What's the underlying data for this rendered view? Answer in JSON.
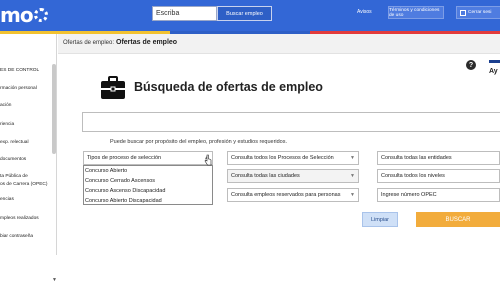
{
  "header": {
    "logo_text": "mo",
    "search_placeholder": "Escriba",
    "search_button": "Buscar empleo",
    "link_avisos": "Avisos",
    "terms_button": "Términos y condiciones de uso",
    "logout_button": "Cerrar sesi"
  },
  "sidebar": {
    "items": [
      "ES DE CONTROL",
      "rmación personal",
      "ación",
      "riencia",
      "exp. relectual",
      "documentos",
      "ta Pública de",
      "os de Carrera (OPEC)",
      "encias",
      "mpleos realizados",
      "biar contraseña"
    ]
  },
  "breadcrumb": {
    "prefix": "Ofertas de empleo:",
    "current": "Ofertas de empleo"
  },
  "help": {
    "ay_label": "Ay"
  },
  "title": "Búsqueda de ofertas de empleo",
  "hint": "Puede buscar por propósito del empleo, profesión y estudios requeridos.",
  "filters": {
    "process_type": "Tipos de proceso de selección",
    "process_selection": "Consulta todos los Procesos de Selección",
    "entities": "Consulta todas las entidades",
    "cities": "Consulta todas las ciudades",
    "levels": "Consulta todos los niveles",
    "reserved": "Consulta empleos reservados para personas",
    "opec_number": "Ingrese número OPEC"
  },
  "dropdown_options": [
    "Concurso Abierto",
    "Concurso Cerrado Ascensos",
    "Concurso Ascenso Discapacidad",
    "Concurso Abierto Discapacidad"
  ],
  "buttons": {
    "clear": "Limpiar",
    "search": "BUSCAR"
  },
  "colors": {
    "topbar": "#3367d6",
    "stripe_yellow": "#f2c230",
    "stripe_red": "#e23b3b",
    "stripe_blue": "#2e5fc6",
    "search_button": "#f2ac3c",
    "clear_button": "#cfe0f7"
  },
  "icons": {
    "help": "question-icon",
    "briefcase": "briefcase-icon",
    "logout": "logout-icon"
  }
}
